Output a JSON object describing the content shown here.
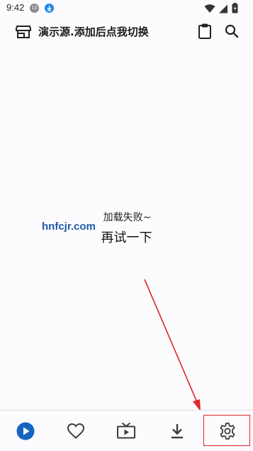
{
  "status_bar": {
    "time": "9:42",
    "notification_badge": "13"
  },
  "app_bar": {
    "title": "演示源.添加后点我切换"
  },
  "content": {
    "error_message": "加载失败~",
    "retry_label": "再试一下",
    "watermark": "hnfcjr.com"
  },
  "bottom_nav": {
    "items": [
      {
        "icon": "play-circle-icon",
        "selected": true
      },
      {
        "icon": "heart-icon",
        "selected": false
      },
      {
        "icon": "tv-icon",
        "selected": false
      },
      {
        "icon": "download-icon",
        "selected": false
      },
      {
        "icon": "settings-gear-icon",
        "selected": false
      }
    ]
  },
  "colors": {
    "accent": "#1565c0",
    "annotation": "#e0262b",
    "icon": "#3c3c3c",
    "background": "#fcfbfd"
  }
}
